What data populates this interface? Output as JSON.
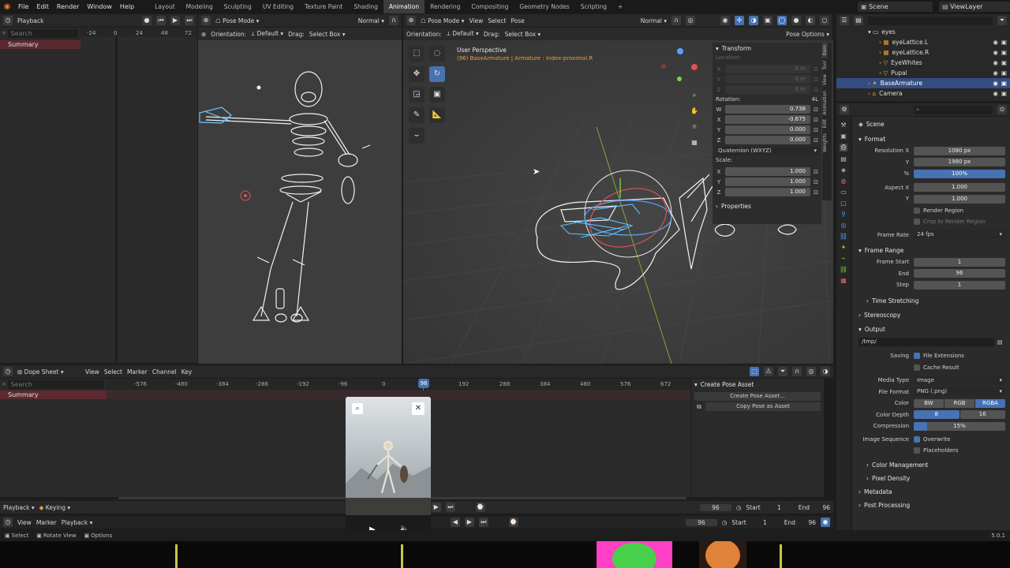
{
  "menubar": {
    "items": [
      "File",
      "Edit",
      "Render",
      "Window",
      "Help"
    ],
    "workspaces": [
      "Layout",
      "Modeling",
      "Sculpting",
      "UV Editing",
      "Texture Paint",
      "Shading",
      "Animation",
      "Rendering",
      "Compositing",
      "Geometry Nodes",
      "Scripting"
    ],
    "active_workspace": "Animation",
    "add_tab": "+",
    "scene": "Scene",
    "view_layer": "ViewLayer"
  },
  "left_timeline": {
    "playback": "Playback",
    "search_placeholder": "Search",
    "summary": "Summary",
    "ticks": [
      "-24",
      "0",
      "24",
      "48",
      "72"
    ]
  },
  "left_viewport": {
    "mode": "Pose Mode",
    "shading": "Normal",
    "orientation_label": "Orientation:",
    "orientation_value": "Default",
    "drag_label": "Drag:",
    "drag_value": "Select Box"
  },
  "main_viewport": {
    "mode": "Pose Mode",
    "menus": [
      "View",
      "Select",
      "Pose"
    ],
    "shading": "Normal",
    "orientation_label": "Orientation:",
    "orientation_value": "Default",
    "drag_label": "Drag:",
    "drag_value": "Select Box",
    "pose_options": "Pose Options",
    "perspective": "User Perspective",
    "info": "(96) BaseArmature | Armature : Index-proximal.R"
  },
  "n_panel": {
    "title": "Transform",
    "location_label": "Location:",
    "location": [
      {
        "axis": "X",
        "value": "0 m"
      },
      {
        "axis": "Y",
        "value": "0 m"
      },
      {
        "axis": "Z",
        "value": "0 m"
      }
    ],
    "rotation_label": "Rotation:",
    "rotation_extra": "4L",
    "rotation": [
      {
        "axis": "W",
        "value": "0.738"
      },
      {
        "axis": "X",
        "value": "-0.675"
      },
      {
        "axis": "Y",
        "value": "0.000"
      },
      {
        "axis": "Z",
        "value": "0.000"
      }
    ],
    "rotation_mode": "Quaternion (WXYZ)",
    "scale_label": "Scale:",
    "scale": [
      {
        "axis": "X",
        "value": "1.000"
      },
      {
        "axis": "Y",
        "value": "1.000"
      },
      {
        "axis": "Z",
        "value": "1.000"
      }
    ],
    "properties": "Properties",
    "tabs": [
      "Item",
      "Tool",
      "View",
      "Animation",
      "Edit",
      "Weights"
    ]
  },
  "outliner": {
    "search_placeholder": "",
    "items": [
      {
        "label": "eyes",
        "indent": 1,
        "icon": "collection"
      },
      {
        "label": "eyeLattice.L",
        "indent": 2,
        "icon": "lattice"
      },
      {
        "label": "eyeLattice.R",
        "indent": 2,
        "icon": "lattice"
      },
      {
        "label": "EyeWhites",
        "indent": 2,
        "icon": "mesh"
      },
      {
        "label": "Pupal",
        "indent": 2,
        "icon": "mesh"
      },
      {
        "label": "BaseArmature",
        "indent": 1,
        "icon": "armature",
        "selected": true
      },
      {
        "label": "Camera",
        "indent": 1,
        "icon": "camera"
      }
    ]
  },
  "properties": {
    "scene_label": "Scene",
    "format": {
      "title": "Format",
      "resolution_x_label": "Resolution X",
      "resolution_x": "1080 px",
      "resolution_y_label": "Y",
      "resolution_y": "1980 px",
      "percent_label": "%",
      "percent": "100%",
      "aspect_x_label": "Aspect X",
      "aspect_x": "1.000",
      "aspect_y_label": "Y",
      "aspect_y": "1.000",
      "render_region": "Render Region",
      "crop_region": "Crop to Render Region",
      "frame_rate_label": "Frame Rate",
      "frame_rate": "24 fps"
    },
    "frame_range": {
      "title": "Frame Range",
      "start_label": "Frame Start",
      "start": "1",
      "end_label": "End",
      "end": "96",
      "step_label": "Step",
      "step": "1"
    },
    "time_stretching": "Time Stretching",
    "stereoscopy": "Stereoscopy",
    "output": {
      "title": "Output",
      "path": "/tmp/",
      "saving_label": "Saving",
      "file_extensions": "File Extensions",
      "cache_result": "Cache Result",
      "media_type_label": "Media Type",
      "media_type": "Image",
      "file_format_label": "File Format",
      "file_format": "PNG (.png)",
      "color_label": "Color",
      "color_options": [
        "BW",
        "RGB",
        "RGBA"
      ],
      "color_depth_label": "Color Depth",
      "color_depth_options": [
        "8",
        "16"
      ],
      "compression_label": "Compression",
      "compression": "15%",
      "image_sequence_label": "Image Sequence",
      "overwrite": "Overwrite",
      "placeholders": "Placeholders"
    },
    "color_management": "Color Management",
    "pixel_density": "Pixel Density",
    "metadata": "Metadata",
    "post_processing": "Post Processing"
  },
  "dopesheet": {
    "editor": "Dope Sheet",
    "menus": [
      "View",
      "Select",
      "Marker",
      "Channel",
      "Key"
    ],
    "search_placeholder": "Search",
    "summary": "Summary",
    "ticks": [
      "-576",
      "-480",
      "-384",
      "-288",
      "-192",
      "-96",
      "0",
      "96",
      "192",
      "288",
      "384",
      "480",
      "576",
      "672"
    ],
    "current_frame": "96",
    "create_pose_header": "Create Pose Asset",
    "create_pose_button": "Create Pose Asset...",
    "copy_pose_button": "Copy Pose as Asset"
  },
  "timeline1": {
    "playback": "Playback",
    "keying": "Keying",
    "current": "96",
    "start_label": "Start",
    "start": "1",
    "end_label": "End",
    "end": "96"
  },
  "timeline2": {
    "menus": [
      "View",
      "Marker",
      "Playback"
    ],
    "current": "96",
    "start_label": "Start",
    "start": "1",
    "end_label": "End",
    "end": "96"
  },
  "statusbar": {
    "select": "Select",
    "rotate_view": "Rotate View",
    "options": "Options",
    "version": "5.0.1"
  },
  "colors": {
    "accent": "#4772b3",
    "header": "#282828",
    "panel": "#303030",
    "viewport": "#3d3d3d",
    "summary": "#5c2a2e"
  }
}
